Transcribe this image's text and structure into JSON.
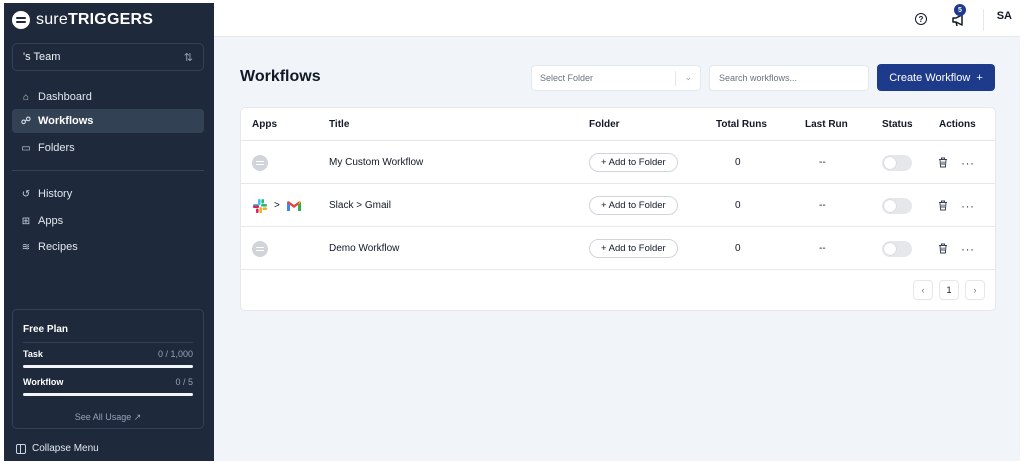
{
  "brand": {
    "logo_prefix": "sure",
    "logo_suffix": "TRIGGERS"
  },
  "team": {
    "name": "'s Team",
    "switch_icon": "sort-arrows-icon"
  },
  "nav": {
    "dashboard": "Dashboard",
    "workflows": "Workflows",
    "folders": "Folders",
    "history": "History",
    "apps": "Apps",
    "recipes": "Recipes"
  },
  "plan": {
    "title": "Free Plan",
    "task_label": "Task",
    "task_value": "0 / 1,000",
    "task_progress": 1.0,
    "workflow_label": "Workflow",
    "workflow_value": "0 / 5",
    "workflow_progress": 1.0,
    "see_all": "See All Usage ↗"
  },
  "collapse": "Collapse Menu",
  "topbar": {
    "help_glyph": "?",
    "notification_count": "5",
    "avatar": "SA"
  },
  "main": {
    "title": "Workflows",
    "select_folder": "Select Folder",
    "search_placeholder": "Search workflows...",
    "create_label": "Create Workflow",
    "create_icon": "+"
  },
  "table": {
    "headers": {
      "apps": "Apps",
      "title": "Title",
      "folder": "Folder",
      "total_runs": "Total Runs",
      "last_run": "Last Run",
      "status": "Status",
      "actions": "Actions"
    },
    "rows": [
      {
        "title": "My Custom Workflow",
        "folder": "+ Add to Folder",
        "total_runs": "0",
        "last_run": "--",
        "apps": [
          "default"
        ]
      },
      {
        "title": "Slack > Gmail",
        "folder": "+ Add to Folder",
        "total_runs": "0",
        "last_run": "--",
        "apps": [
          "slack",
          "gmail"
        ],
        "app_separator": ">"
      },
      {
        "title": "Demo Workflow",
        "folder": "+ Add to Folder",
        "total_runs": "0",
        "last_run": "--",
        "apps": [
          "default"
        ]
      }
    ],
    "more_glyph": "···"
  },
  "pagination": {
    "prev": "‹",
    "current": "1",
    "next": "›"
  },
  "colors": {
    "sidebar": "#1e293b",
    "accent": "#1e3a8a",
    "main_bg": "#f1f5f9"
  }
}
